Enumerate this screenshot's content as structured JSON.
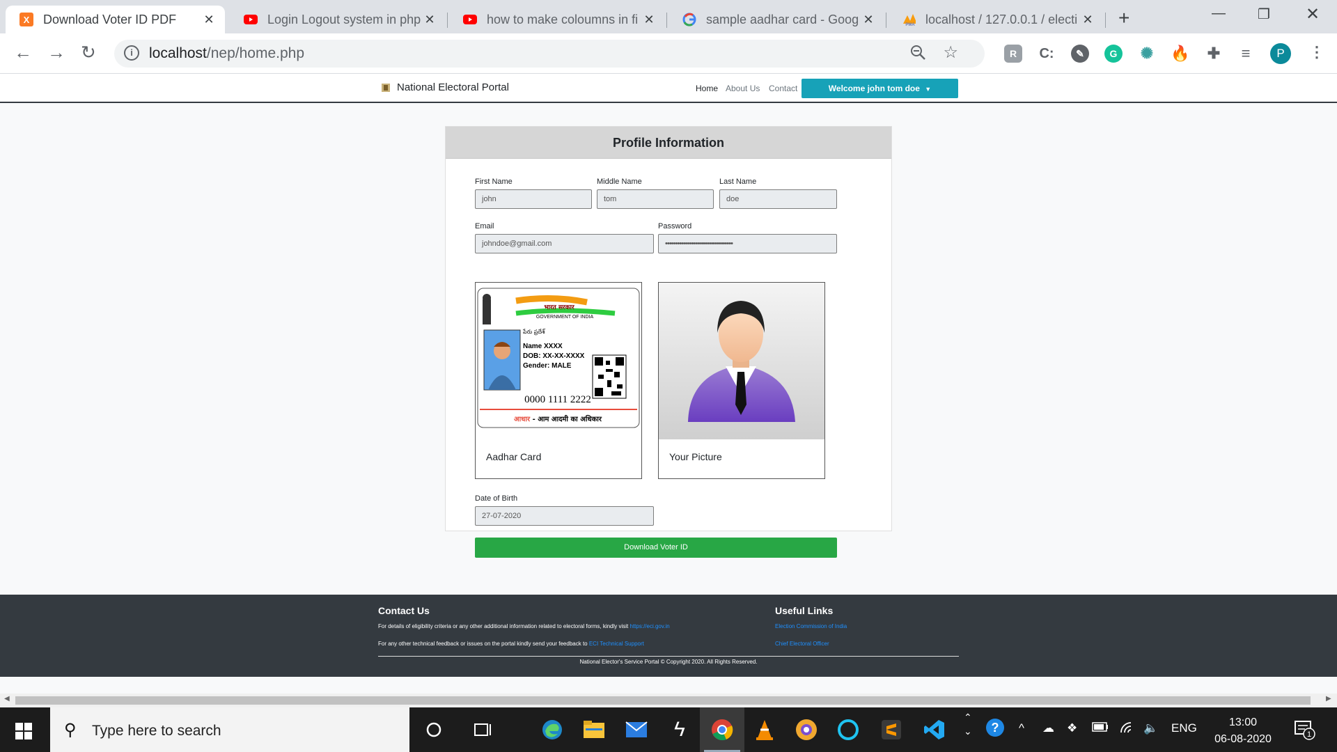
{
  "browser": {
    "tabs": [
      {
        "title": "Download Voter ID PDF",
        "favicon": "xampp-icon",
        "active": true
      },
      {
        "title": "Login Logout system in php",
        "favicon": "youtube-icon"
      },
      {
        "title": "how to make coloumns in fi",
        "favicon": "youtube-icon"
      },
      {
        "title": "sample aadhar card - Goog",
        "favicon": "google-icon"
      },
      {
        "title": "localhost / 127.0.0.1 / electi",
        "favicon": "phpmyadmin-icon"
      }
    ],
    "url_host": "localhost",
    "url_path": "/nep/home.php",
    "profile_initial": "P"
  },
  "site": {
    "brand": "National Electoral Portal",
    "nav": {
      "home": "Home",
      "about": "About Us",
      "contact": "Contact"
    },
    "welcome": "Welcome john tom doe"
  },
  "profile": {
    "title": "Profile Information",
    "first_name_label": "First Name",
    "first_name": "john",
    "middle_name_label": "Middle Name",
    "middle_name": "tom",
    "last_name_label": "Last Name",
    "last_name": "doe",
    "email_label": "Email",
    "email": "johndoe@gmail.com",
    "password_label": "Password",
    "password": "••••••••••••••••••••••••••••••••••",
    "aadhar_caption": "Aadhar Card",
    "picture_caption": "Your Picture",
    "dob_label": "Date of Birth",
    "dob": "27-07-2020",
    "download_button": "Download Voter ID"
  },
  "aadhar_card": {
    "hindi_govt": "भारत सरकार",
    "govt": "GOVERNMENT OF INDIA",
    "telugu_name": "పేరు ప్రదేశ్",
    "name": "Name XXXX",
    "dob": "DOB: XX-XX-XXXX",
    "gender": "Gender: MALE",
    "number": "0000 1111 2222",
    "tagline_red": "आधार",
    "tagline": " - आम आदमी का अधिकार"
  },
  "footer": {
    "contact_title": "Contact Us",
    "contact_line1": "For details of eligibility criteria or any other additional information related to electoral forms, kindly visit ",
    "contact_link1": "https://eci.gov.in",
    "contact_line2": "For any other technical feedback or issues on the portal kindly send your feedback to ",
    "contact_link2": "ECI Technical Support",
    "links_title": "Useful Links",
    "link_a": "Election Commission of India",
    "link_b": "Chief Electoral Officer",
    "copyright": "National Elector's Service Portal © Copyright 2020. All Rights Reserved."
  },
  "taskbar": {
    "search_placeholder": "Type here to search",
    "lang": "ENG",
    "time": "13:00",
    "date": "06-08-2020",
    "notifications": "1"
  }
}
